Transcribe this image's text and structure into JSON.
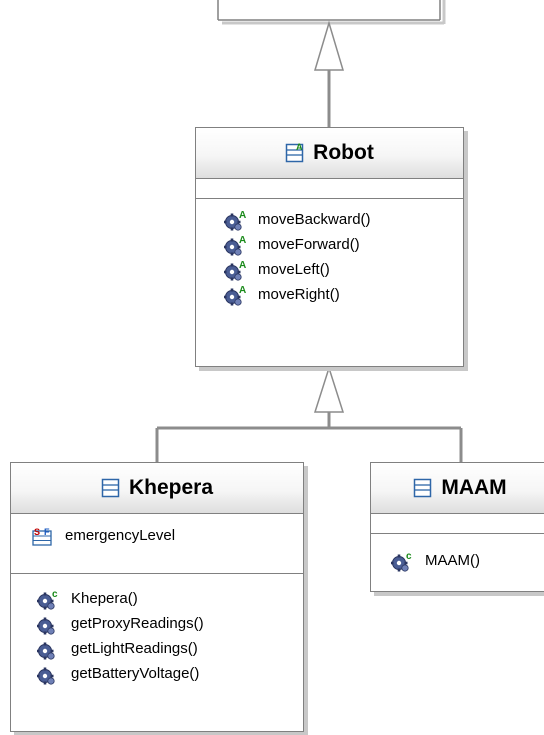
{
  "classes": {
    "robot": {
      "name": "Robot",
      "stereotype_icon": "abstract-class-icon",
      "methods": [
        {
          "label": "moveBackward()",
          "icon": "abstract-method-icon"
        },
        {
          "label": "moveForward()",
          "icon": "abstract-method-icon"
        },
        {
          "label": "moveLeft()",
          "icon": "abstract-method-icon"
        },
        {
          "label": "moveRight()",
          "icon": "abstract-method-icon"
        }
      ]
    },
    "khepera": {
      "name": "Khepera",
      "stereotype_icon": "class-icon",
      "fields": [
        {
          "label": "emergencyLevel",
          "icon": "static-final-field-icon"
        }
      ],
      "methods": [
        {
          "label": "Khepera()",
          "icon": "constructor-icon"
        },
        {
          "label": "getProxyReadings()",
          "icon": "method-icon"
        },
        {
          "label": "getLightReadings()",
          "icon": "method-icon"
        },
        {
          "label": "getBatteryVoltage()",
          "icon": "method-icon"
        }
      ]
    },
    "maam": {
      "name": "MAAM",
      "stereotype_icon": "class-icon",
      "methods": [
        {
          "label": "MAAM()",
          "icon": "constructor-icon"
        }
      ]
    }
  },
  "colors": {
    "border": "#808080",
    "shadow": "#c8c8c8",
    "connector": "#8c8c8c",
    "class_icon": "#2e66a8",
    "gear": "#3a4a7a",
    "abstract_marker": "#1a8a1a",
    "field_marker": "#c00000"
  }
}
